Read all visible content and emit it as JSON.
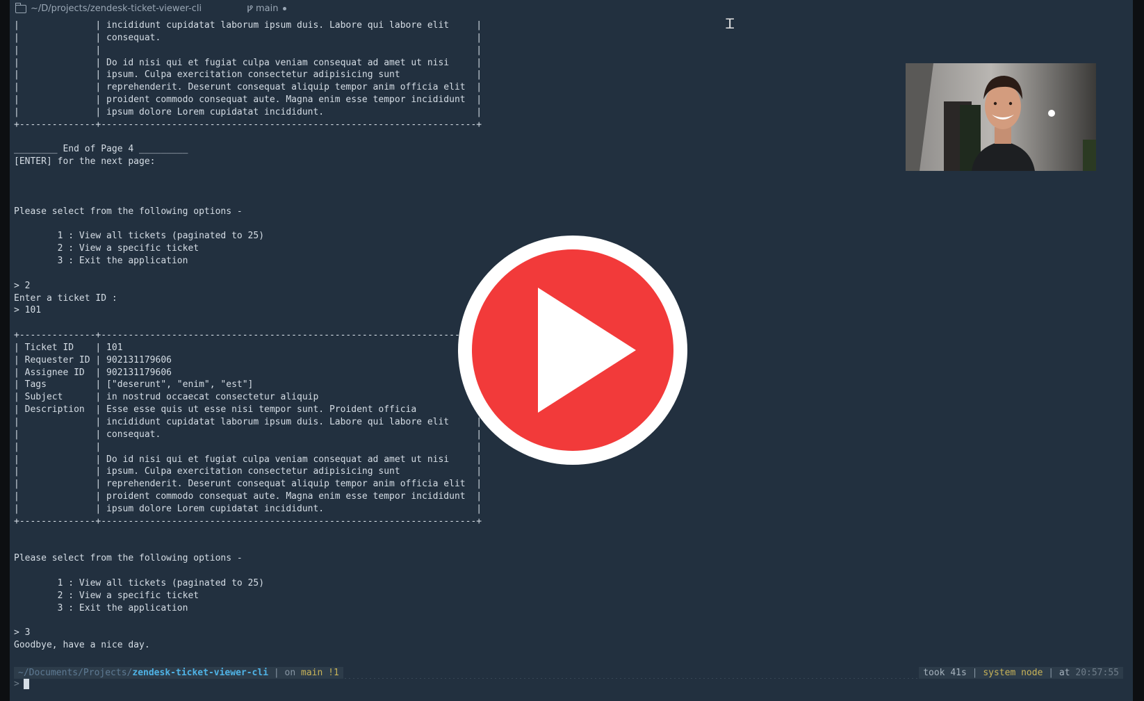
{
  "titlebar": {
    "path": "~/D/projects/zendesk-ticket-viewer-cli",
    "branch": "main",
    "branch_icon": "git-branch-icon"
  },
  "terminal_output": "|              | incididunt cupidatat laborum ipsum duis. Labore qui labore elit     |\n|              | consequat.                                                          |\n|              |                                                                     |\n|              | Do id nisi qui et fugiat culpa veniam consequat ad amet ut nisi     |\n|              | ipsum. Culpa exercitation consectetur adipisicing sunt              |\n|              | reprehenderit. Deserunt consequat aliquip tempor anim officia elit  |\n|              | proident commodo consequat aute. Magna enim esse tempor incididunt  |\n|              | ipsum dolore Lorem cupidatat incididunt.                            |\n+--------------+---------------------------------------------------------------------+\n\n________ End of Page 4 _________\n[ENTER] for the next page:\n\n\n\nPlease select from the following options -\n\n        1 : View all tickets (paginated to 25)\n        2 : View a specific ticket\n        3 : Exit the application\n\n> 2\nEnter a ticket ID :\n> 101\n\n+--------------+---------------------------------------------------------------------+\n| Ticket ID    | 101\n| Requester ID | 902131179606\n| Assignee ID  | 902131179606\n| Tags         | [\"deserunt\", \"enim\", \"est\"]\n| Subject      | in nostrud occaecat consectetur aliquip\n| Description  | Esse esse quis ut esse nisi tempor sunt. Proident officia\n|              | incididunt cupidatat laborum ipsum duis. Labore qui labore elit     |\n|              | consequat.                                                          |\n|              |                                                                     |\n|              | Do id nisi qui et fugiat culpa veniam consequat ad amet ut nisi     |\n|              | ipsum. Culpa exercitation consectetur adipisicing sunt              |\n|              | reprehenderit. Deserunt consequat aliquip tempor anim officia elit  |\n|              | proident commodo consequat aute. Magna enim esse tempor incididunt  |\n|              | ipsum dolore Lorem cupidatat incididunt.                            |\n+--------------+---------------------------------------------------------------------+\n\n\nPlease select from the following options -\n\n        1 : View all tickets (paginated to 25)\n        2 : View a specific ticket\n        3 : Exit the application\n\n> 3\nGoodbye, have a nice day.",
  "prompt": {
    "dir_prefix": "~/Documents/Projects/",
    "repo": "zendesk-ticket-viewer-cli",
    "sep1": " | ",
    "on_label": "on ",
    "branch": "main !1",
    "took": "took 41s",
    "sep2": " | ",
    "node": "system node",
    "sep3": " | ",
    "at_label": "at ",
    "time": "20:57:55",
    "input_symbol": ">"
  },
  "overlay": {
    "play_icon": "play-icon",
    "webcam": "webcam-video",
    "colors": {
      "play_red": "#f23a3a",
      "play_ring": "#ffffff"
    }
  },
  "colors": {
    "terminal_bg": "#22303f",
    "text": "#d5dde5",
    "repo_blue": "#4fb3e6",
    "accent_yellow": "#c9b458"
  }
}
